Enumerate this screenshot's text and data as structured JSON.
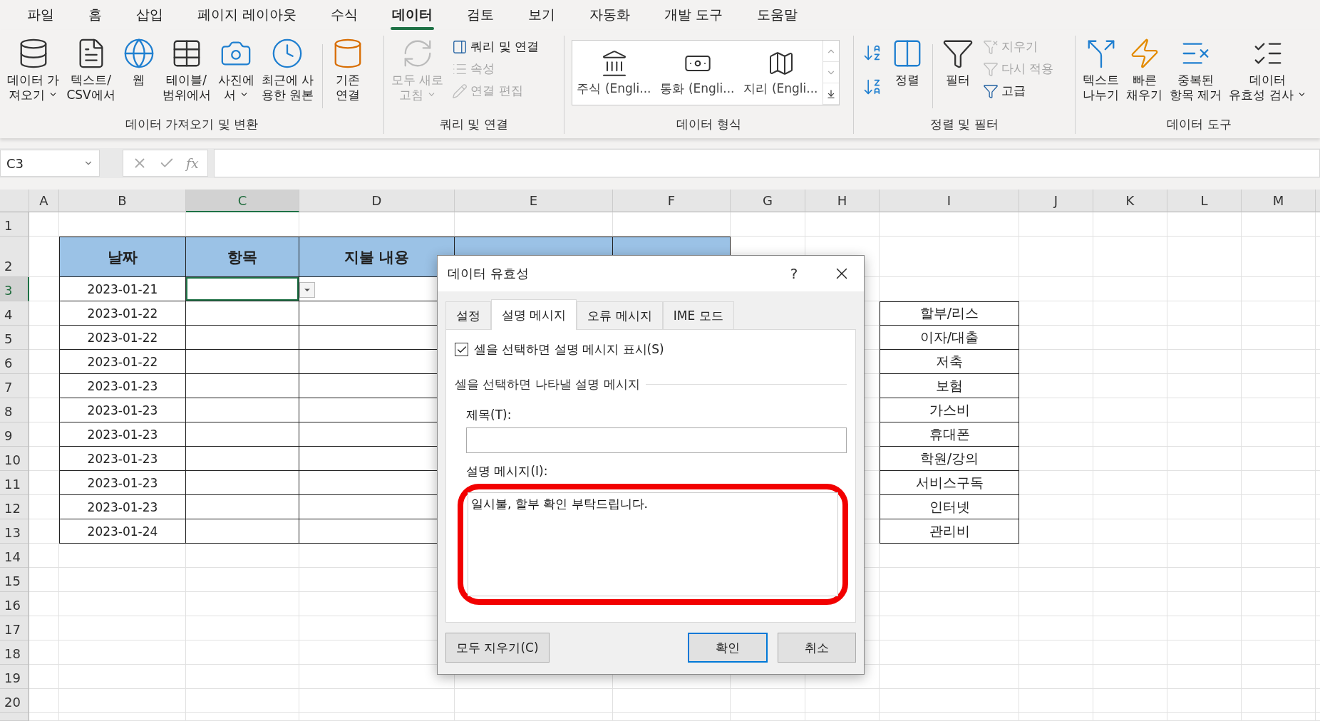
{
  "menu": {
    "tabs": [
      {
        "label": "파일",
        "selected": false
      },
      {
        "label": "홈",
        "selected": false
      },
      {
        "label": "삽입",
        "selected": false
      },
      {
        "label": "페이지 레이아웃",
        "selected": false
      },
      {
        "label": "수식",
        "selected": false
      },
      {
        "label": "데이터",
        "selected": true
      },
      {
        "label": "검토",
        "selected": false
      },
      {
        "label": "보기",
        "selected": false
      },
      {
        "label": "자동화",
        "selected": false
      },
      {
        "label": "개발 도구",
        "selected": false
      },
      {
        "label": "도움말",
        "selected": false
      }
    ]
  },
  "ribbon": {
    "groups": [
      {
        "label": "데이터 가져오기 및 변환",
        "items": [
          {
            "kind": "large",
            "lines": [
              "데이터 가",
              "져오기"
            ],
            "dropdown": true,
            "disabled": false
          },
          {
            "kind": "large",
            "lines": [
              "텍스트/",
              "CSV에서"
            ],
            "dropdown": false,
            "disabled": false
          },
          {
            "kind": "large",
            "lines": [
              "웹"
            ],
            "dropdown": false,
            "disabled": false
          },
          {
            "kind": "large",
            "lines": [
              "테이블/",
              "범위에서"
            ],
            "dropdown": false,
            "disabled": false
          },
          {
            "kind": "large",
            "lines": [
              "사진에",
              "서"
            ],
            "dropdown": true,
            "disabled": false
          },
          {
            "kind": "large",
            "lines": [
              "최근에 사",
              "용한 원본"
            ],
            "dropdown": false,
            "disabled": false
          },
          {
            "kind": "separator"
          },
          {
            "kind": "large",
            "lines": [
              "기존",
              "연결"
            ],
            "dropdown": false,
            "disabled": false
          }
        ]
      },
      {
        "label": "쿼리 및 연결",
        "items": [
          {
            "kind": "large",
            "lines": [
              "모두 새로",
              "고침"
            ],
            "dropdown": true,
            "disabled": true
          },
          {
            "kind": "stack",
            "items": [
              {
                "label": "쿼리 및 연결",
                "disabled": false
              },
              {
                "label": "속성",
                "disabled": true
              },
              {
                "label": "연결 편집",
                "disabled": true
              }
            ]
          }
        ]
      },
      {
        "label": "데이터 형식",
        "items": [
          {
            "kind": "gallery",
            "items": [
              "주식 (Engli...",
              "통화 (Engli...",
              "지리 (Engli..."
            ]
          }
        ]
      },
      {
        "label": "정렬 및 필터",
        "items": [
          {
            "kind": "icon-stack",
            "items": [
              {
                "disabled": false
              },
              {
                "disabled": false
              }
            ]
          },
          {
            "kind": "large",
            "lines": [
              "정렬"
            ],
            "dropdown": false,
            "disabled": false
          },
          {
            "kind": "separator"
          },
          {
            "kind": "large",
            "lines": [
              "필터"
            ],
            "dropdown": false,
            "disabled": false
          },
          {
            "kind": "stack",
            "items": [
              {
                "label": "지우기",
                "disabled": true
              },
              {
                "label": "다시 적용",
                "disabled": true
              },
              {
                "label": "고급",
                "disabled": false
              }
            ]
          }
        ]
      },
      {
        "label": "데이터 도구",
        "items": [
          {
            "kind": "large",
            "lines": [
              "텍스트",
              "나누기"
            ],
            "dropdown": false,
            "disabled": false
          },
          {
            "kind": "large",
            "lines": [
              "빠른",
              "채우기"
            ],
            "dropdown": false,
            "disabled": false
          },
          {
            "kind": "large",
            "lines": [
              "중복된",
              "항목 제거"
            ],
            "dropdown": false,
            "disabled": false
          },
          {
            "kind": "large",
            "lines": [
              "데이터",
              "유효성 검사"
            ],
            "dropdown": true,
            "disabled": false
          }
        ]
      }
    ]
  },
  "formula_bar": {
    "name_box": "C3",
    "function_label": "fx"
  },
  "sheet": {
    "columns": [
      {
        "label": "A",
        "selected": false
      },
      {
        "label": "B",
        "selected": false
      },
      {
        "label": "C",
        "selected": true
      },
      {
        "label": "D",
        "selected": false
      },
      {
        "label": "E",
        "selected": false
      },
      {
        "label": "F",
        "selected": false
      },
      {
        "label": "G",
        "selected": false
      },
      {
        "label": "H",
        "selected": false
      },
      {
        "label": "I",
        "selected": false
      },
      {
        "label": "J",
        "selected": false
      },
      {
        "label": "K",
        "selected": false
      },
      {
        "label": "L",
        "selected": false
      },
      {
        "label": "M",
        "selected": false
      }
    ],
    "rows": [
      {
        "label": "1",
        "selected": false
      },
      {
        "label": "2",
        "selected": false
      },
      {
        "label": "3",
        "selected": true
      },
      {
        "label": "4",
        "selected": false
      },
      {
        "label": "5",
        "selected": false
      },
      {
        "label": "6",
        "selected": false
      },
      {
        "label": "7",
        "selected": false
      },
      {
        "label": "8",
        "selected": false
      },
      {
        "label": "9",
        "selected": false
      },
      {
        "label": "10",
        "selected": false
      },
      {
        "label": "11",
        "selected": false
      },
      {
        "label": "12",
        "selected": false
      },
      {
        "label": "13",
        "selected": false
      },
      {
        "label": "14",
        "selected": false
      },
      {
        "label": "15",
        "selected": false
      },
      {
        "label": "16",
        "selected": false
      },
      {
        "label": "17",
        "selected": false
      },
      {
        "label": "18",
        "selected": false
      },
      {
        "label": "19",
        "selected": false
      },
      {
        "label": "20",
        "selected": false
      }
    ],
    "table_headers": [
      "날짜",
      "항목",
      "지불 내용"
    ],
    "dates": [
      "2023-01-21",
      "2023-01-22",
      "2023-01-22",
      "2023-01-22",
      "2023-01-23",
      "2023-01-23",
      "2023-01-23",
      "2023-01-23",
      "2023-01-23",
      "2023-01-23",
      "2023-01-24"
    ],
    "cell_dropdown": true,
    "category_list": [
      "할부/리스",
      "이자/대출",
      "저축",
      "보험",
      "가스비",
      "휴대폰",
      "학원/강의",
      "서비스구독",
      "인터넷",
      "관리비"
    ]
  },
  "dialog": {
    "title": "데이터 유효성",
    "help": "?",
    "tabs": [
      {
        "label": "설정",
        "selected": false
      },
      {
        "label": "설명 메시지",
        "selected": true
      },
      {
        "label": "오류 메시지",
        "selected": false
      },
      {
        "label": "IME 모드",
        "selected": false
      }
    ],
    "show_message": {
      "label": "셀을 선택하면 설명 메시지 표시(S)",
      "checked": true
    },
    "section_label": "셀을 선택하면 나타낼 설명 메시지",
    "title_field": {
      "label": "제목(T):"
    },
    "message_field": {
      "label": "설명 메시지(I):",
      "value": "일시불, 할부 확인 부탁드립니다.",
      "highlighted": true
    },
    "buttons": [
      {
        "label": "모두 지우기(C)",
        "default": false
      },
      {
        "label": "확인",
        "default": true
      },
      {
        "label": "취소",
        "default": false
      }
    ]
  }
}
